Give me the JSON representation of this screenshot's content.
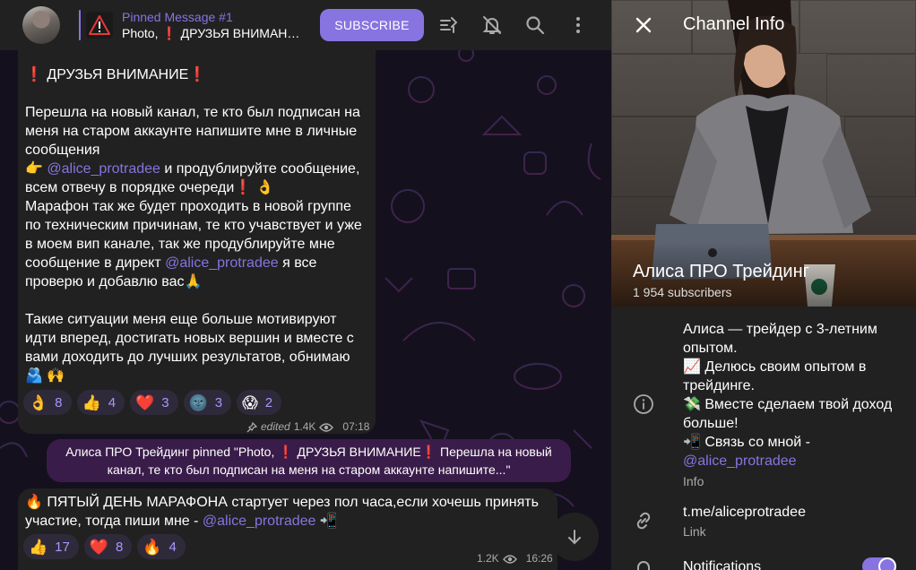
{
  "header": {
    "pinned_title": "Pinned Message #1",
    "pinned_desc": "Photo, ❗ ДРУЗЬЯ ВНИМАНИЕ❗",
    "subscribe_label": "SUBSCRIBE"
  },
  "messages": [
    {
      "line_title": "❗ ДРУЗЬЯ ВНИМАНИЕ❗",
      "para1": "Перешла на новый канал, те кто был подписан на меня на старом аккаунте напишите мне в личные сообщения",
      "point_prefix": "👉 ",
      "mention1": "@alice_protradee",
      "point_rest": " и продублируйте сообщение, всем отвечу в порядке очереди❗ 👌",
      "para2": "Марафон так же будет проходить в новой группе по техническим причинам, те кто учавствует и уже в моем вип канале, так же продублируйте мне сообщение в директ ",
      "mention2": "@alice_protradee",
      "para2_end": " я все проверю и добавлю вас🙏",
      "para3": "Такие ситуации меня еще больше мотивируют идти вперед, достигать новых вершин и вместе с вами доходить до лучших результатов, обнимаю 🫂 🙌",
      "reactions": [
        {
          "emoji": "👌",
          "count": "8"
        },
        {
          "emoji": "👍",
          "count": "4"
        },
        {
          "emoji": "❤️",
          "count": "3"
        },
        {
          "emoji": "🌚",
          "count": "3"
        },
        {
          "emoji": "😱",
          "count": "2"
        }
      ],
      "edited": "edited",
      "views": "1.4K",
      "time": "07:18"
    },
    {
      "text_start": "🔥 ПЯТЫЙ ДЕНЬ МАРАФОНА стартует через пол часа,если хочешь принять участие, тогда пиши мне - ",
      "mention": "@alice_protradee",
      "text_end": " 📲",
      "reactions": [
        {
          "emoji": "👍",
          "count": "17"
        },
        {
          "emoji": "❤️",
          "count": "8"
        },
        {
          "emoji": "🔥",
          "count": "4"
        }
      ],
      "views": "1.2K",
      "time": "16:26"
    }
  ],
  "service_message": "Алиса ПРО Трейдинг pinned \"Photo, ❗ ДРУЗЬЯ ВНИМАНИЕ❗  Перешла на новый канал, те кто был подписан на меня на старом аккаунте напишите...\"",
  "panel": {
    "title": "Channel Info",
    "channel_name": "Алиса ПРО Трейдинг",
    "subscribers": "1 954 subscribers",
    "info_text": "Алиса — трейдер с 3-летним опытом.\n📈  Делюсь своим опытом в трейдинге.\n💸  Вместе сделаем твой доход больше!\n📲  Связь со мной - ",
    "info_mention": "@alice_protradee",
    "info_label": "Info",
    "link_text": "t.me/aliceprotradee",
    "link_label": "Link",
    "notifications_label": "Notifications"
  },
  "colors": {
    "accent": "#8774e1",
    "bubble": "#212121",
    "service": "#3a1c4a"
  }
}
